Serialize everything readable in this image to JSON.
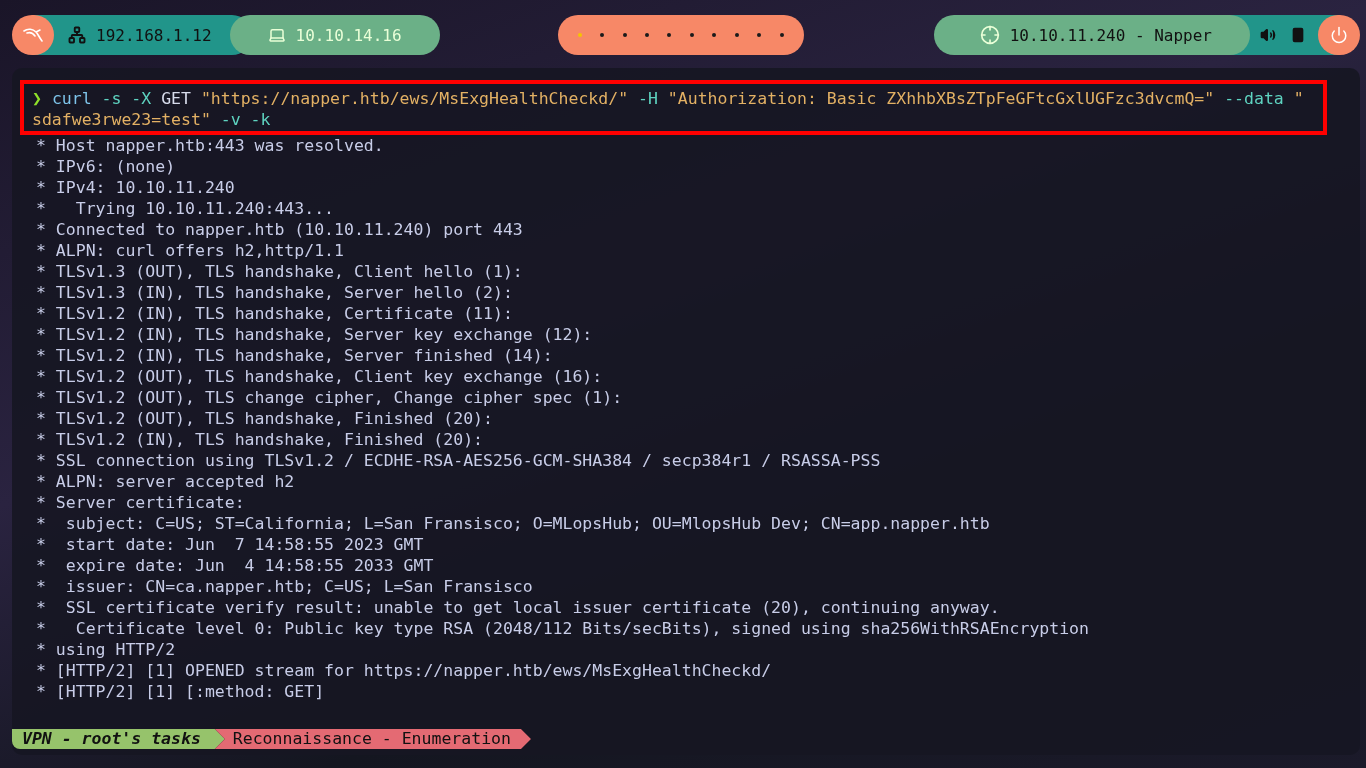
{
  "top_bar": {
    "left": {
      "lan_ip": "192.168.1.12",
      "vpn_ip": "10.10.14.16"
    },
    "workspaces": [
      {
        "selected": true
      },
      {
        "selected": false
      },
      {
        "selected": false
      },
      {
        "selected": false
      },
      {
        "selected": false
      },
      {
        "selected": false
      },
      {
        "selected": false
      },
      {
        "selected": false
      },
      {
        "selected": false
      },
      {
        "selected": false
      }
    ],
    "target": "10.10.11.240 - Napper"
  },
  "terminal": {
    "command_lines": [
      [
        {
          "kind": "prompt",
          "text": "❯"
        },
        {
          "kind": "command",
          "text": "curl"
        },
        {
          "kind": "flag",
          "text": "-s -X"
        },
        {
          "kind": "plain",
          "text": "GET"
        },
        {
          "kind": "string",
          "text": "\"https://napper.htb/ews/MsExgHealthCheckd/\""
        },
        {
          "kind": "flag",
          "text": "-H"
        },
        {
          "kind": "string",
          "text": "\"Authorization: Basic ZXhhbXBsZTpFeGFtcGxlUGFzc3dvcmQ=\""
        },
        {
          "kind": "flag",
          "text": "--data"
        },
        {
          "kind": "string",
          "text": "\""
        }
      ],
      [
        {
          "kind": "string",
          "text": "sdafwe3rwe23=test\""
        },
        {
          "kind": "flag",
          "text": "-v -k"
        }
      ]
    ],
    "output": [
      "* Host napper.htb:443 was resolved.",
      "* IPv6: (none)",
      "* IPv4: 10.10.11.240",
      "*   Trying 10.10.11.240:443...",
      "* Connected to napper.htb (10.10.11.240) port 443",
      "* ALPN: curl offers h2,http/1.1",
      "* TLSv1.3 (OUT), TLS handshake, Client hello (1):",
      "* TLSv1.3 (IN), TLS handshake, Server hello (2):",
      "* TLSv1.2 (IN), TLS handshake, Certificate (11):",
      "* TLSv1.2 (IN), TLS handshake, Server key exchange (12):",
      "* TLSv1.2 (IN), TLS handshake, Server finished (14):",
      "* TLSv1.2 (OUT), TLS handshake, Client key exchange (16):",
      "* TLSv1.2 (OUT), TLS change cipher, Change cipher spec (1):",
      "* TLSv1.2 (OUT), TLS handshake, Finished (20):",
      "* TLSv1.2 (IN), TLS handshake, Finished (20):",
      "* SSL connection using TLSv1.2 / ECDHE-RSA-AES256-GCM-SHA384 / secp384r1 / RSASSA-PSS",
      "* ALPN: server accepted h2",
      "* Server certificate:",
      "*  subject: C=US; ST=California; L=San Fransisco; O=MLopsHub; OU=MlopsHub Dev; CN=app.napper.htb",
      "*  start date: Jun  7 14:58:55 2023 GMT",
      "*  expire date: Jun  4 14:58:55 2033 GMT",
      "*  issuer: CN=ca.napper.htb; C=US; L=San Fransisco",
      "*  SSL certificate verify result: unable to get local issuer certificate (20), continuing anyway.",
      "*   Certificate level 0: Public key type RSA (2048/112 Bits/secBits), signed using sha256WithRSAEncryption",
      "* using HTTP/2",
      "* [HTTP/2] [1] OPENED stream for https://napper.htb/ews/MsExgHealthCheckd/",
      "* [HTTP/2] [1] [:method: GET]"
    ],
    "status": {
      "session": "VPN - root's tasks",
      "task": "Reconnaissance - Enumeration"
    }
  }
}
